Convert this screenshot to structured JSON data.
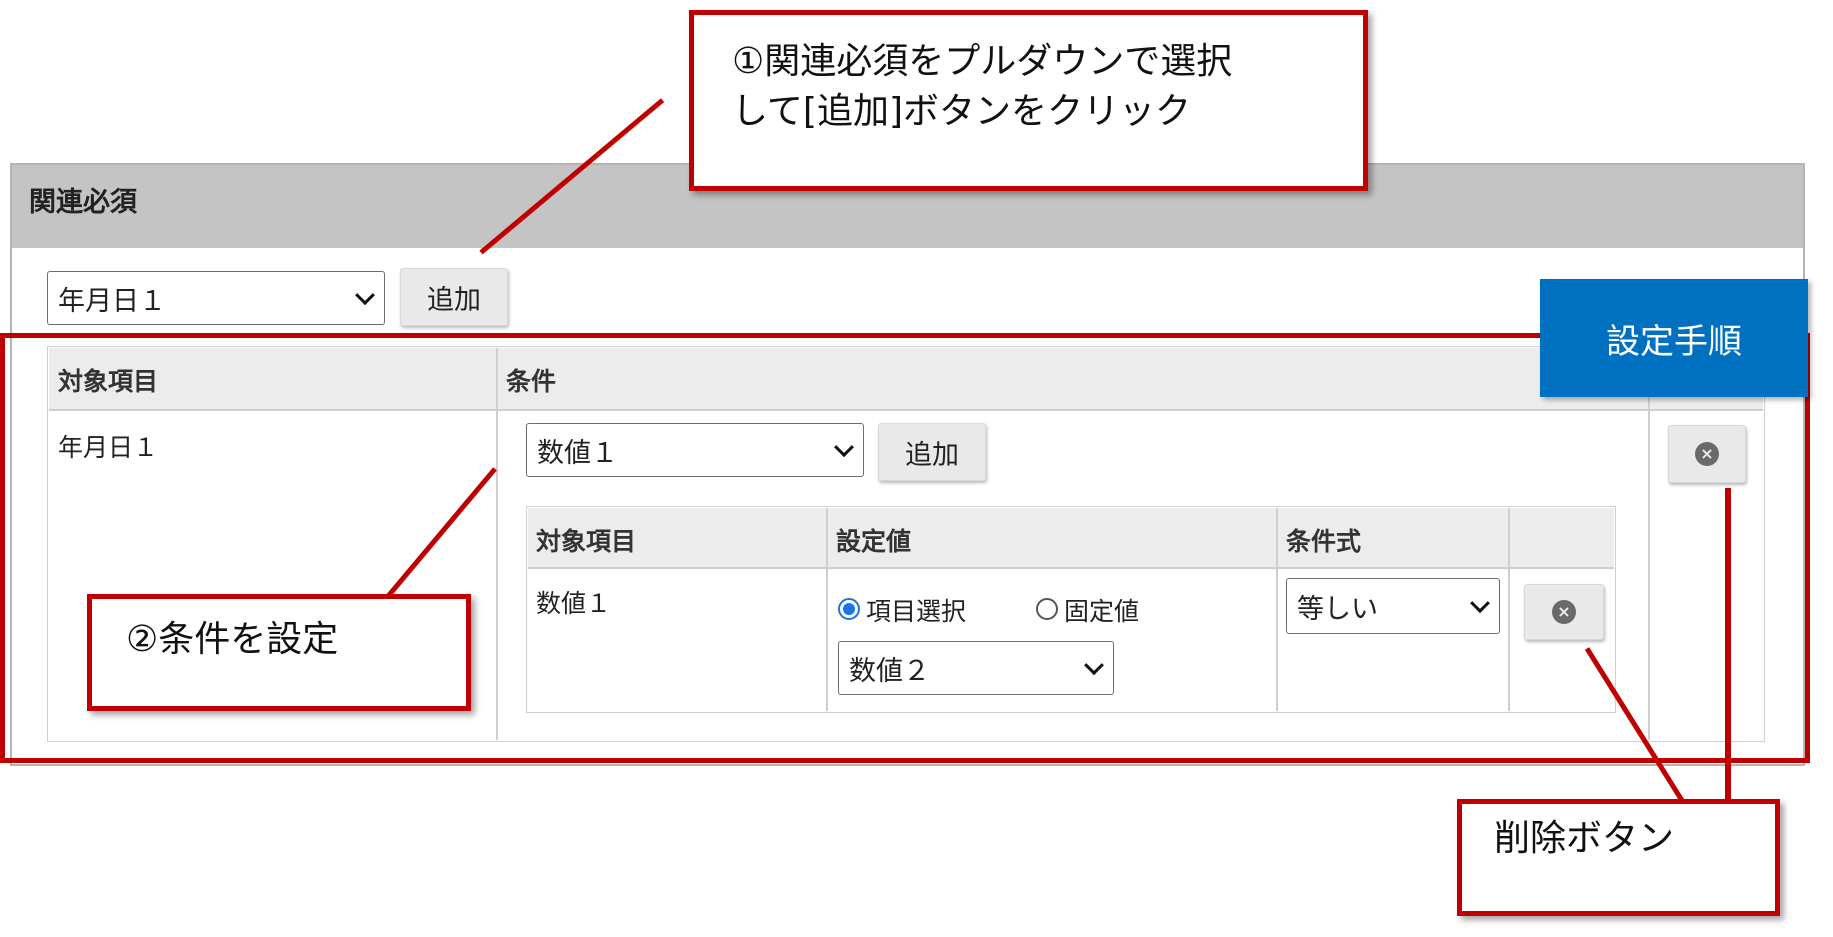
{
  "panel": {
    "title": "関連必須"
  },
  "top_select": {
    "value": "年月日１"
  },
  "top_add_button": "追加",
  "outer_table": {
    "headers": [
      "対象項目",
      "条件"
    ],
    "row": {
      "target": "年月日１"
    }
  },
  "condition_select": {
    "value": "数値１"
  },
  "condition_add_button": "追加",
  "inner_table": {
    "headers": [
      "対象項目",
      "設定値",
      "条件式"
    ],
    "row": {
      "target": "数値１",
      "radio_item": "項目選択",
      "radio_fixed": "固定値",
      "value_select": "数値２",
      "operator_select": "等しい"
    }
  },
  "delete_icon_glyph": "×",
  "callouts": {
    "step1_line1": "①関連必須をプルダウンで選択",
    "step1_line2": "して[追加]ボタンをクリック",
    "step2": "②条件を設定",
    "delete": "削除ボタン"
  },
  "badge": "設定手順",
  "colors": {
    "accent_red": "#c00000",
    "badge_blue": "#0070c0",
    "radio_blue": "#1a73e8"
  }
}
